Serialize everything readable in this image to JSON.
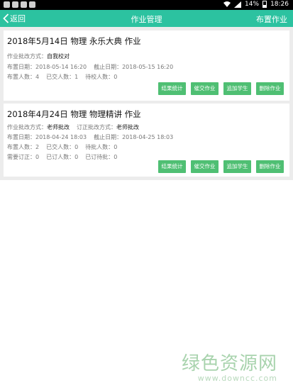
{
  "status_bar": {
    "battery": "14%",
    "time": "18:26"
  },
  "header": {
    "back_label": "返回",
    "title": "作业管理",
    "action_label": "布置作业"
  },
  "assignments": [
    {
      "title": "2018年5月14日  物理 永乐大典  作业",
      "review_method_label": "作业批改方式：",
      "review_method": "自我校对",
      "assign_date_label": "布置日期：",
      "assign_date": "2018-05-14 16:20",
      "deadline_label": "截止日期：",
      "deadline": "2018-05-15 16:20",
      "assigned_label": "布置人数：",
      "assigned": "4",
      "submitted_label": "已交人数：",
      "submitted": "1",
      "pending_label": "待校人数：",
      "pending": "0",
      "buttons": [
        "结果统计",
        "催交作业",
        "追加学生",
        "删除作业"
      ]
    },
    {
      "title": "2018年4月24日  物理 物理精讲  作业",
      "review_method_label": "作业批改方式：",
      "review_method": "老师批改",
      "correction_method_label": "订正批改方式：",
      "correction_method": "老师批改",
      "assign_date_label": "布置日期：",
      "assign_date": "2018-04-24 18:03",
      "deadline_label": "截止日期：",
      "deadline": "2018-04-25 18:03",
      "assigned_label": "布置人数：",
      "assigned": "2",
      "submitted_label": "已交人数：",
      "submitted": "0",
      "pending_label": "待批人数：",
      "pending": "0",
      "need_correct_label": "需要订正：",
      "need_correct": "0",
      "corrected_label": "已订人数：",
      "corrected": "0",
      "reviewed_label": "已订待批：",
      "reviewed": "0",
      "buttons": [
        "结果统计",
        "催交作业",
        "追加学生",
        "删除作业"
      ]
    }
  ],
  "watermark": {
    "main": "绿色资源网",
    "url": "www.downcc.com"
  },
  "colors": {
    "header": "#2cc2a0",
    "button": "#4fbf73",
    "content_bg": "#ececec"
  }
}
